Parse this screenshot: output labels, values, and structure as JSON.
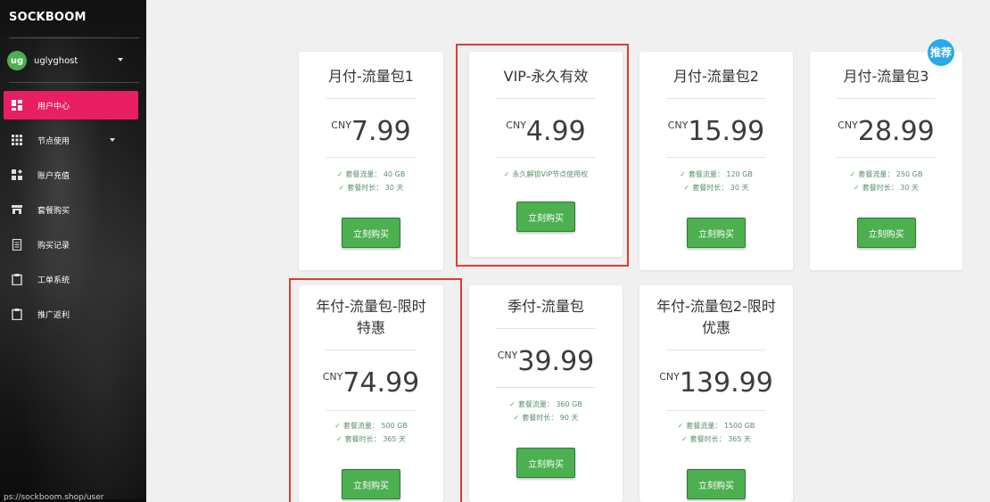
{
  "sidebar": {
    "brand": "SOCKBOOM",
    "user": {
      "initials": "ug",
      "name": "uglyghost"
    },
    "items": [
      {
        "label": "用户中心",
        "icon": "dashboard-icon",
        "active": true
      },
      {
        "label": "节点使用",
        "icon": "grid-icon",
        "active": false
      },
      {
        "label": "账户充值",
        "icon": "recharge-icon",
        "active": false
      },
      {
        "label": "套餐购买",
        "icon": "store-icon",
        "active": false
      },
      {
        "label": "购买记录",
        "icon": "receipt-icon",
        "active": false
      },
      {
        "label": "工单系统",
        "icon": "clipboard-icon",
        "active": false
      },
      {
        "label": "推广返利",
        "icon": "clipboard-icon",
        "active": false
      }
    ],
    "url_hint": "ps://sockboom.shop/user"
  },
  "badge": {
    "label": "推荐"
  },
  "plans": [
    {
      "title": "月付-流量包1",
      "currency": "CNY",
      "price": "7.99",
      "features": [
        "套餐流量： 40 GB",
        "套餐时长： 30 天"
      ],
      "button": "立刻购买"
    },
    {
      "title": "VIP-永久有效",
      "currency": "CNY",
      "price": "4.99",
      "features": [
        "永久解锁VIP节点使用权"
      ],
      "button": "立刻购买"
    },
    {
      "title": "月付-流量包2",
      "currency": "CNY",
      "price": "15.99",
      "features": [
        "套餐流量： 120 GB",
        "套餐时长： 30 天"
      ],
      "button": "立刻购买"
    },
    {
      "title": "月付-流量包3",
      "currency": "CNY",
      "price": "28.99",
      "features": [
        "套餐流量： 250 GB",
        "套餐时长： 30 天"
      ],
      "button": "立刻购买"
    },
    {
      "title": "年付-流量包-限时特惠",
      "currency": "CNY",
      "price": "74.99",
      "features": [
        "套餐流量： 500 GB",
        "套餐时长： 365 天"
      ],
      "button": "立刻购买"
    },
    {
      "title": "季付-流量包",
      "currency": "CNY",
      "price": "39.99",
      "features": [
        "套餐流量： 360 GB",
        "套餐时长： 90 天"
      ],
      "button": "立刻购买"
    },
    {
      "title": "年付-流量包2-限时优惠",
      "currency": "CNY",
      "price": "139.99",
      "features": [
        "套餐流量： 1500 GB",
        "套餐时长： 365 天"
      ],
      "button": "立刻购买"
    }
  ],
  "colors": {
    "accent": "#e91e63",
    "buy": "#4caf50",
    "highlight": "#e53935",
    "badge": "#29a9ea"
  }
}
